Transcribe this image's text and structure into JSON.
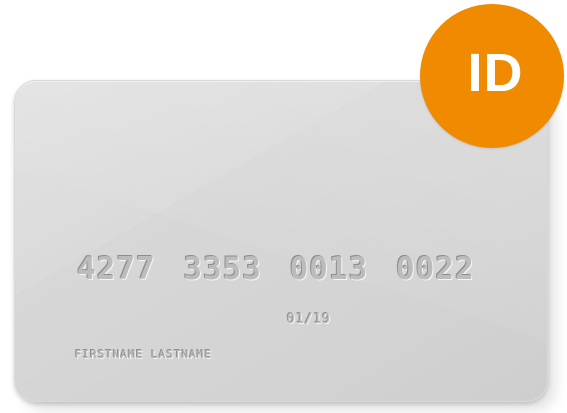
{
  "card": {
    "number": "4277 3353 0013 0022",
    "expiry": "01/19",
    "holder": "FIRSTNAME LASTNAME"
  },
  "badge": {
    "label": "ID",
    "color": "#f08a00"
  }
}
